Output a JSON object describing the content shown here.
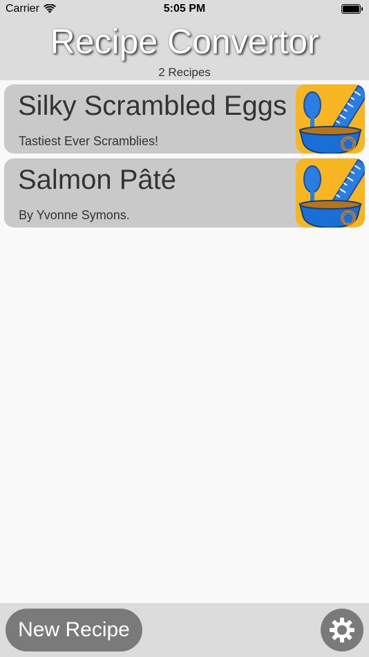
{
  "status_bar": {
    "carrier": "Carrier",
    "time": "5:05 PM",
    "icons": [
      "wifi-icon",
      "battery-icon"
    ]
  },
  "header": {
    "title": "Recipe Convertor",
    "count": "2 Recipes"
  },
  "recipes": [
    {
      "title": "Silky Scrambled Eggs",
      "subtitle": "Tastiest Ever Scramblies!",
      "icon": "recipe-app-icon"
    },
    {
      "title": "Salmon Pâté",
      "subtitle": "By Yvonne Symons.",
      "icon": "recipe-app-icon"
    }
  ],
  "toolbar": {
    "new_recipe_label": "New Recipe",
    "settings_icon": "gear-icon"
  },
  "colors": {
    "header_background": "#dcdcdc",
    "card_background": "#c9c9c9",
    "button_background": "#7a7a7a",
    "icon_yellow": "#f7b622",
    "icon_blue": "#1a6fd6"
  }
}
